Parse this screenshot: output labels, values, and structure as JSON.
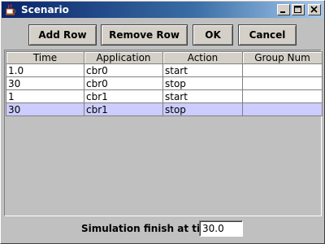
{
  "window": {
    "title": "Scenario",
    "controls": [
      "minimize",
      "maximize",
      "close"
    ]
  },
  "toolbar": {
    "add_label": "Add Row",
    "remove_label": "Remove Row",
    "ok_label": "OK",
    "cancel_label": "Cancel"
  },
  "table": {
    "columns": [
      "Time",
      "Application",
      "Action",
      "Group Num"
    ],
    "rows": [
      [
        "1.0",
        "cbr0",
        "start",
        ""
      ],
      [
        "30",
        "cbr0",
        "stop",
        ""
      ],
      [
        "1",
        "cbr1",
        "start",
        ""
      ],
      [
        "30",
        "cbr1",
        "stop",
        ""
      ]
    ],
    "selected_row": 3
  },
  "footer": {
    "finish_label": "Simulation finish at time",
    "finish_value": "30.0"
  },
  "colors": {
    "title_bar": "#0a246a",
    "selected_row": "#ccccff",
    "background": "#c0c0c0"
  }
}
